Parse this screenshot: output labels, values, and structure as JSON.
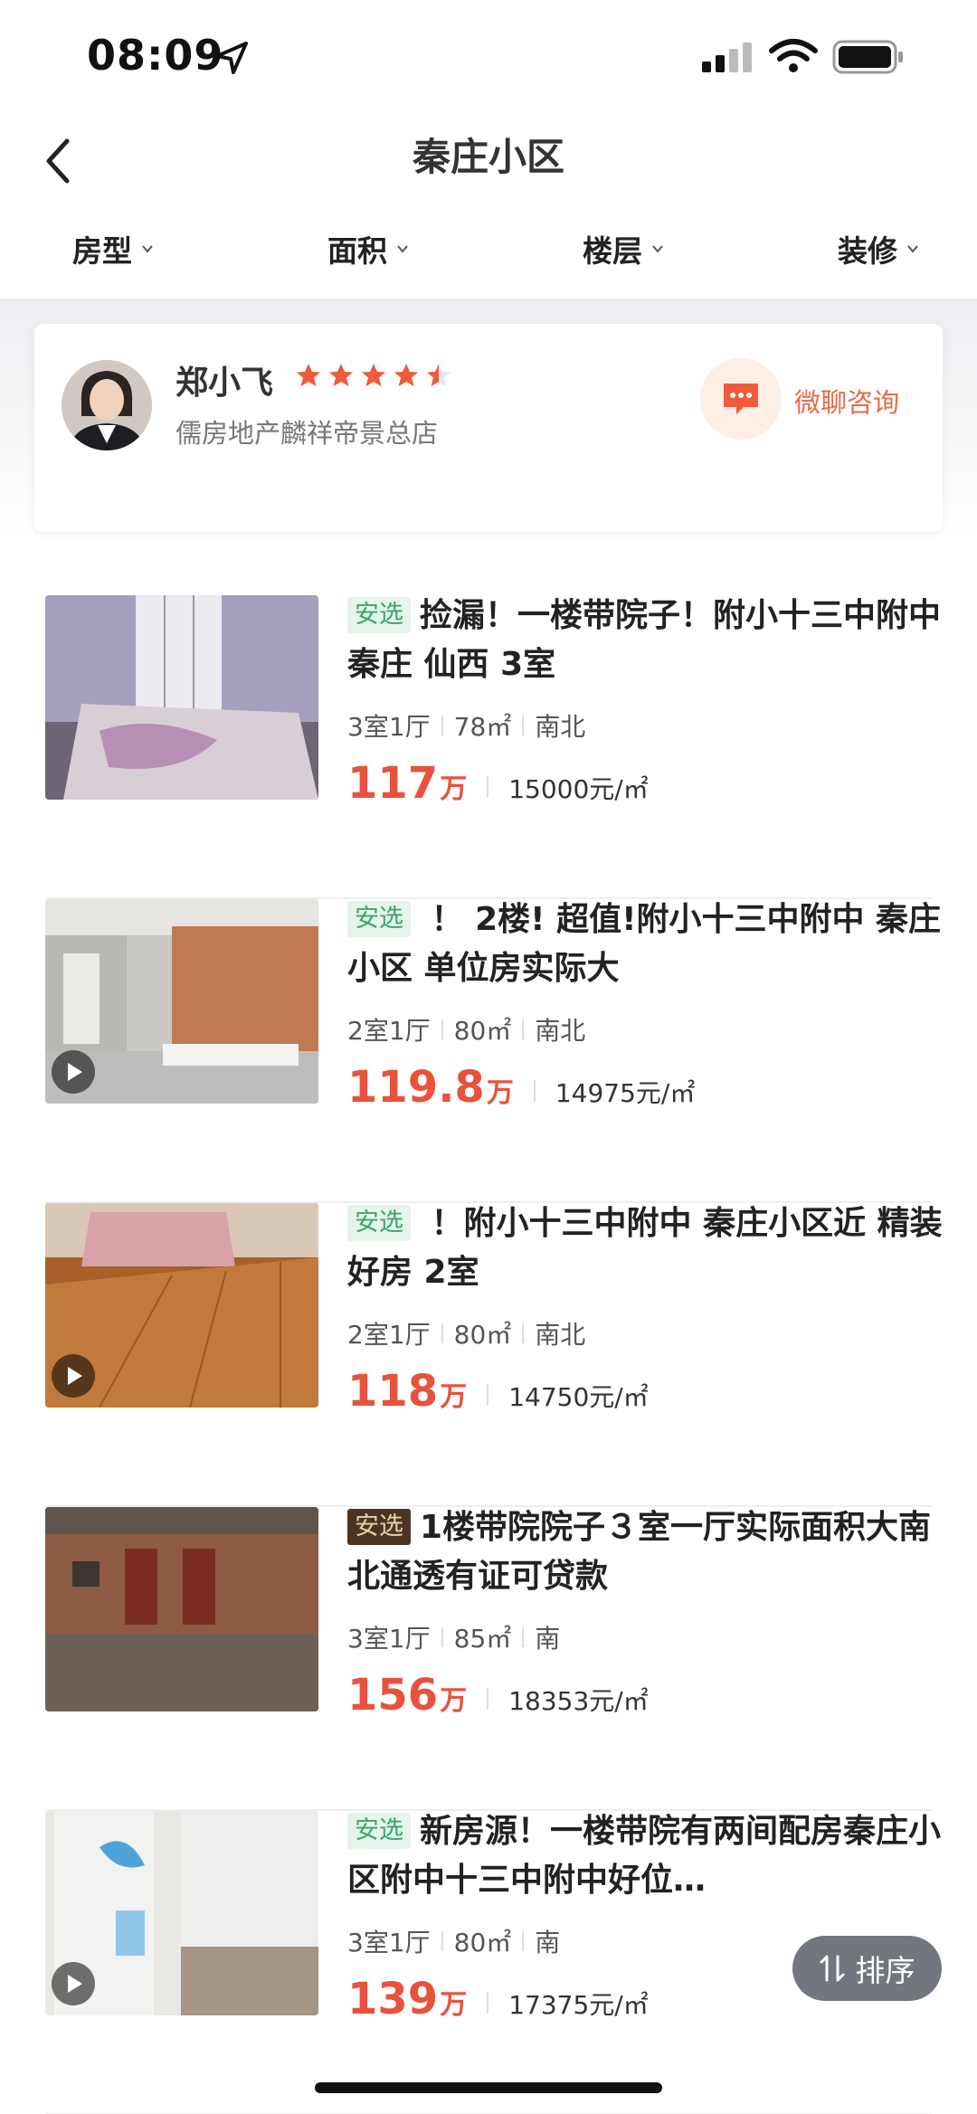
{
  "status_bar": {
    "time": "08:09"
  },
  "nav": {
    "title": "秦庄小区"
  },
  "filters": [
    {
      "label": "房型"
    },
    {
      "label": "面积"
    },
    {
      "label": "楼层"
    },
    {
      "label": "装修"
    }
  ],
  "agent": {
    "name": "郑小飞",
    "rating": 4.5,
    "company": "儒房地产麟祥帝景总店",
    "chat_label": "微聊咨询"
  },
  "listings": [
    {
      "tag": "安选",
      "tag_style": "light",
      "title": "捡漏！一楼带院子！附小十三中附中 秦庄 仙西 3室",
      "layout": "3室1厅",
      "area": "78㎡",
      "orientation": "南北",
      "price": "117",
      "price_unit": "万",
      "unit_price": "15000元/㎡",
      "has_video": false
    },
    {
      "tag": "安选",
      "tag_style": "light",
      "title": " ！ 2楼! 超值!附小十三中附中 秦庄小区 单位房实际大",
      "layout": "2室1厅",
      "area": "80㎡",
      "orientation": "南北",
      "price": "119.8",
      "price_unit": "万",
      "unit_price": "14975元/㎡",
      "has_video": true
    },
    {
      "tag": "安选",
      "tag_style": "light",
      "title": " ！附小十三中附中 秦庄小区近 精装好房 2室",
      "layout": "2室1厅",
      "area": "80㎡",
      "orientation": "南北",
      "price": "118",
      "price_unit": "万",
      "unit_price": "14750元/㎡",
      "has_video": true
    },
    {
      "tag": "安选",
      "tag_style": "dark",
      "title": "1楼带院院子３室一厅实际面积大南北通透有证可贷款",
      "layout": "3室1厅",
      "area": "85㎡",
      "orientation": "南",
      "price": "156",
      "price_unit": "万",
      "unit_price": "18353元/㎡",
      "has_video": false
    },
    {
      "tag": "安选",
      "tag_style": "light",
      "title": "新房源！一楼带院有两间配房秦庄小区附中十三中附中好位…",
      "layout": "3室1厅",
      "area": "80㎡",
      "orientation": "南",
      "price": "139",
      "price_unit": "万",
      "unit_price": "17375元/㎡",
      "has_video": true
    }
  ],
  "sort_button": {
    "label": "排序"
  },
  "colors": {
    "price": "#e8523c",
    "accent": "#e96a46",
    "tag_green": "#3aa56c",
    "tag_dark_bg": "#4a3524"
  }
}
